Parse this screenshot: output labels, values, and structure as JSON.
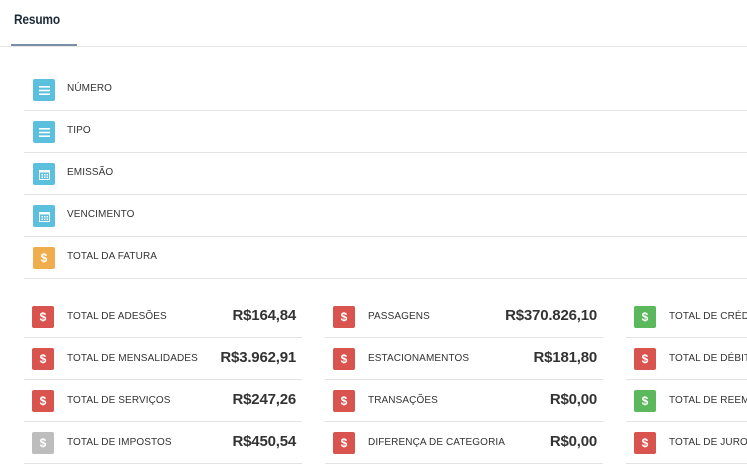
{
  "header": {
    "title": "Resumo"
  },
  "info_rows": [
    {
      "label": "NÚMERO",
      "icon": "list-icon",
      "color": "#5bc0de"
    },
    {
      "label": "TIPO",
      "icon": "list-icon",
      "color": "#5bc0de"
    },
    {
      "label": "EMISSÃO",
      "icon": "calendar-icon",
      "color": "#5bc0de"
    },
    {
      "label": "VENCIMENTO",
      "icon": "calendar-icon",
      "color": "#5bc0de"
    },
    {
      "label": "TOTAL DA FATURA",
      "icon": "dollar-icon",
      "color": "#f0ad4e"
    }
  ],
  "column1": [
    {
      "label": "TOTAL DE ADESÕES",
      "value": "R$164,84",
      "color": "#d9534f"
    },
    {
      "label": "TOTAL DE MENSALIDADES",
      "value": "R$3.962,91",
      "color": "#d9534f"
    },
    {
      "label": "TOTAL DE SERVIÇOS",
      "value": "R$247,26",
      "color": "#d9534f"
    },
    {
      "label": "TOTAL DE IMPOSTOS",
      "value": "R$450,54",
      "color": "#bdbdbd"
    }
  ],
  "column2": [
    {
      "label": "PASSAGENS",
      "value": "R$370.826,10",
      "color": "#d9534f"
    },
    {
      "label": "ESTACIONAMENTOS",
      "value": "R$181,80",
      "color": "#d9534f"
    },
    {
      "label": "TRANSAÇÕES",
      "value": "R$0,00",
      "color": "#d9534f"
    },
    {
      "label": "DIFERENÇA DE CATEGORIA",
      "value": "R$0,00",
      "color": "#d9534f"
    }
  ],
  "column3": [
    {
      "label": "TOTAL DE CRÉDITOS",
      "color": "#5cb85c"
    },
    {
      "label": "TOTAL DE DÉBITOS",
      "color": "#d9534f"
    },
    {
      "label": "TOTAL DE REEMBOLSOS",
      "color": "#5cb85c"
    },
    {
      "label": "TOTAL DE JUROS",
      "color": "#d9534f"
    }
  ],
  "icons": {
    "dollar_glyph": "$"
  }
}
